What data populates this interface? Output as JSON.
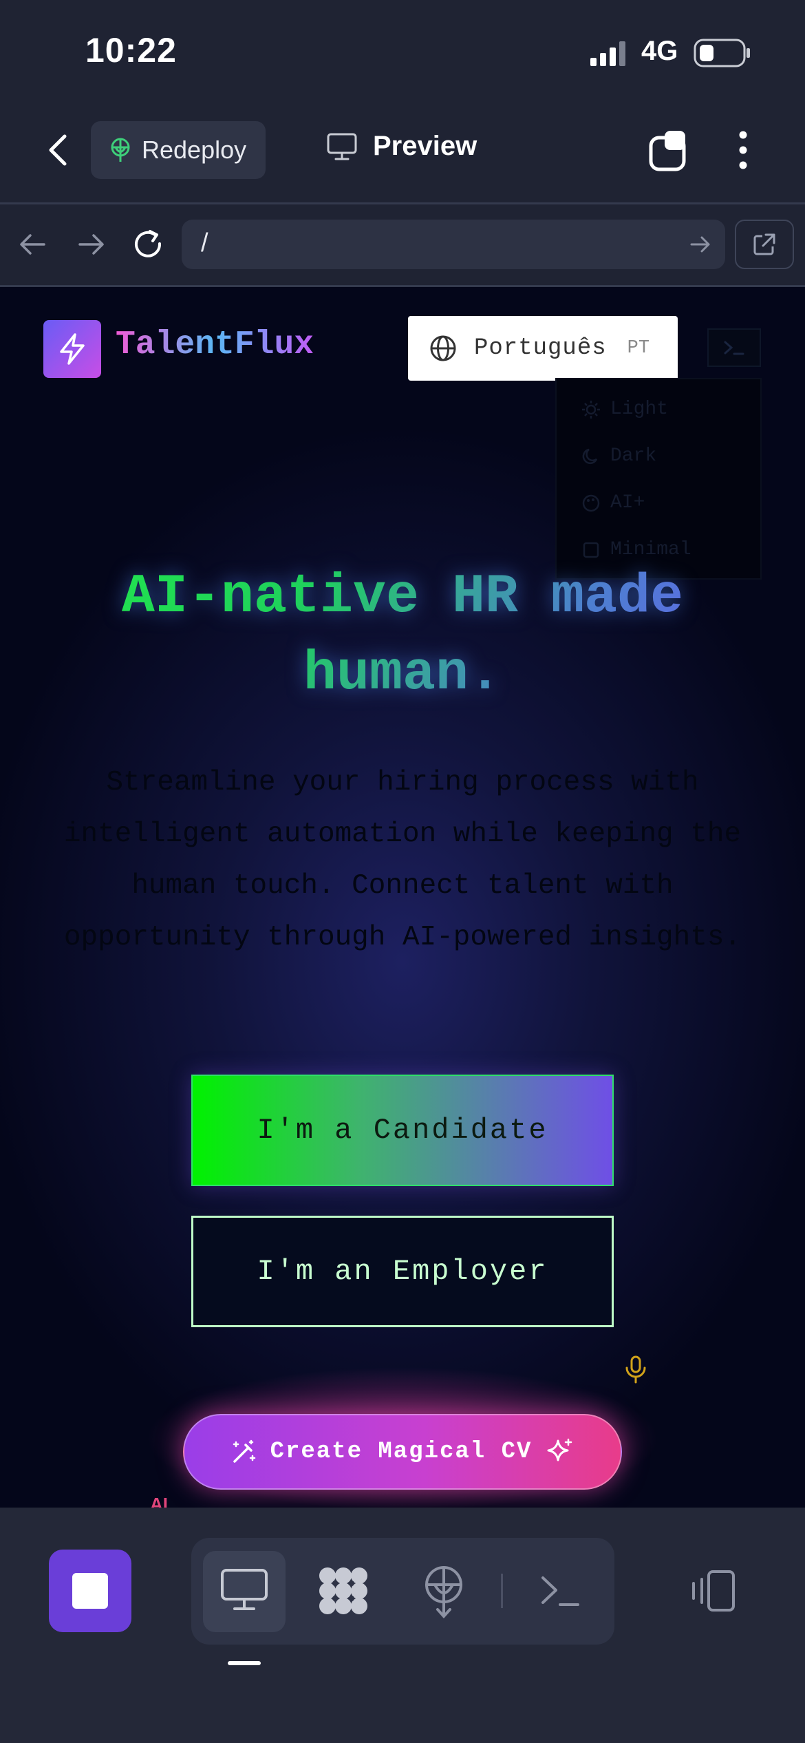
{
  "status_bar": {
    "time": "10:22",
    "network": "4G",
    "signal_bars_active": 3,
    "battery_level": 0.3
  },
  "toolbar": {
    "redeploy_label": "Redeploy",
    "preview_label": "Preview"
  },
  "address_bar": {
    "url": "/"
  },
  "site": {
    "brand": "TalentFlux",
    "language": {
      "label": "Português",
      "code": "PT"
    },
    "theme_menu": [
      "Light",
      "Dark",
      "AI+",
      "Minimal"
    ],
    "hero_line1": "AI-native HR made",
    "hero_line2": "human.",
    "subtitle": "Streamline your hiring process with intelligent automation while keeping the human touch. Connect talent with opportunity through AI-powered insights.",
    "candidate_button": "I'm a Candidate",
    "employer_button": "I'm an Employer",
    "cv_button": "Create Magical CV",
    "ai_badge_peek": "AI"
  },
  "bottom_bar": {
    "active_tab": "preview"
  },
  "colors": {
    "accent_green": "#22e84a",
    "accent_purple": "#6a5cf5",
    "accent_pink": "#e83c8a",
    "chrome_bg": "#1f2333",
    "stop_button": "#6a3ed8"
  }
}
